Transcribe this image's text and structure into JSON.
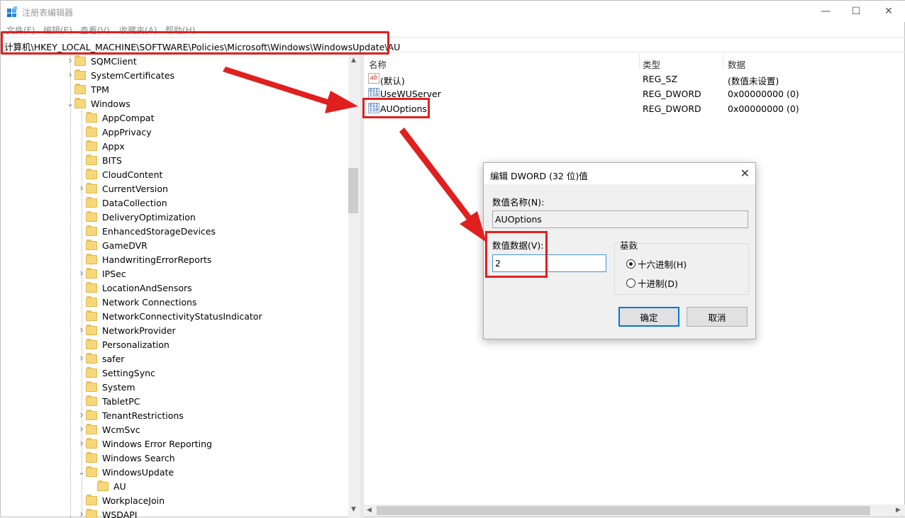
{
  "window": {
    "title": "注册表编辑器",
    "minimize": "—",
    "maximize": "☐",
    "close": "✕"
  },
  "menu": [
    "文件(F)",
    "编辑(E)",
    "查看(V)",
    "收藏夹(A)",
    "帮助(H)"
  ],
  "address": "计算机\\HKEY_LOCAL_MACHINE\\SOFTWARE\\Policies\\Microsoft\\Windows\\WindowsUpdate\\AU",
  "tree": {
    "items": [
      {
        "label": "SQMClient",
        "level": 0,
        "expand": ">"
      },
      {
        "label": "SystemCertificates",
        "level": 0,
        "expand": ">"
      },
      {
        "label": "TPM",
        "level": 0,
        "expand": ""
      },
      {
        "label": "Windows",
        "level": 0,
        "expand": "v"
      },
      {
        "label": "AppCompat",
        "level": 1,
        "expand": ""
      },
      {
        "label": "AppPrivacy",
        "level": 1,
        "expand": ""
      },
      {
        "label": "Appx",
        "level": 1,
        "expand": ""
      },
      {
        "label": "BITS",
        "level": 1,
        "expand": ""
      },
      {
        "label": "CloudContent",
        "level": 1,
        "expand": ""
      },
      {
        "label": "CurrentVersion",
        "level": 1,
        "expand": ">"
      },
      {
        "label": "DataCollection",
        "level": 1,
        "expand": ""
      },
      {
        "label": "DeliveryOptimization",
        "level": 1,
        "expand": ""
      },
      {
        "label": "EnhancedStorageDevices",
        "level": 1,
        "expand": ""
      },
      {
        "label": "GameDVR",
        "level": 1,
        "expand": ""
      },
      {
        "label": "HandwritingErrorReports",
        "level": 1,
        "expand": ""
      },
      {
        "label": "IPSec",
        "level": 1,
        "expand": ">"
      },
      {
        "label": "LocationAndSensors",
        "level": 1,
        "expand": ""
      },
      {
        "label": "Network Connections",
        "level": 1,
        "expand": ""
      },
      {
        "label": "NetworkConnectivityStatusIndicator",
        "level": 1,
        "expand": ""
      },
      {
        "label": "NetworkProvider",
        "level": 1,
        "expand": ">"
      },
      {
        "label": "Personalization",
        "level": 1,
        "expand": ""
      },
      {
        "label": "safer",
        "level": 1,
        "expand": ">"
      },
      {
        "label": "SettingSync",
        "level": 1,
        "expand": ""
      },
      {
        "label": "System",
        "level": 1,
        "expand": ""
      },
      {
        "label": "TabletPC",
        "level": 1,
        "expand": ""
      },
      {
        "label": "TenantRestrictions",
        "level": 1,
        "expand": ">"
      },
      {
        "label": "WcmSvc",
        "level": 1,
        "expand": ">"
      },
      {
        "label": "Windows Error Reporting",
        "level": 1,
        "expand": ">"
      },
      {
        "label": "Windows Search",
        "level": 1,
        "expand": ""
      },
      {
        "label": "WindowsUpdate",
        "level": 1,
        "expand": "v"
      },
      {
        "label": "AU",
        "level": 2,
        "expand": ""
      },
      {
        "label": "WorkplaceJoin",
        "level": 1,
        "expand": ""
      },
      {
        "label": "WSDAPI",
        "level": 1,
        "expand": ">"
      }
    ]
  },
  "list": {
    "columns": [
      "名称",
      "类型",
      "数据"
    ],
    "rows": [
      {
        "name": "(默认)",
        "type": "REG_SZ",
        "data": "(数值未设置)",
        "icon": "string-value-icon",
        "glyph": "ab"
      },
      {
        "name": "UseWUServer",
        "type": "REG_DWORD",
        "data": "0x00000000 (0)",
        "icon": "dword-value-icon",
        "glyph": "011\n110"
      },
      {
        "name": "AUOptions",
        "type": "REG_DWORD",
        "data": "0x00000000 (0)",
        "icon": "dword-value-icon",
        "glyph": "011\n110"
      }
    ]
  },
  "dialog": {
    "title": "编辑 DWORD (32 位)值",
    "close": "✕",
    "name_label": "数值名称(N):",
    "name_value": "AUOptions",
    "data_label": "数值数据(V):",
    "data_value": "2",
    "base_label": "基数",
    "base_options": [
      "十六进制(H)",
      "十进制(D)"
    ],
    "base_selected": "十六进制(H)",
    "ok": "确定",
    "cancel": "取消"
  },
  "colors": {
    "annotation_red": "#e0201f",
    "folder": "#f6d77a",
    "focus_blue": "#0078d7"
  }
}
